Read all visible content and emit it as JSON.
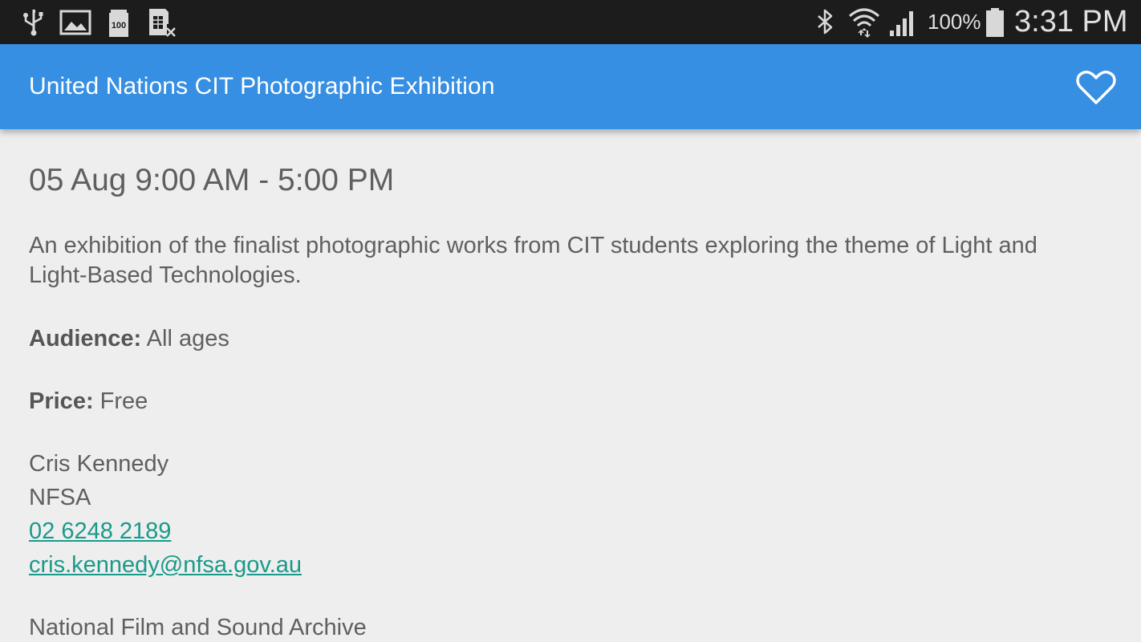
{
  "status_bar": {
    "icons_left": [
      "usb-icon",
      "image-icon",
      "storage-100-icon",
      "sim-off-icon"
    ],
    "icons_right": [
      "bluetooth-icon",
      "wifi-icon",
      "signal-icon",
      "battery-icon"
    ],
    "battery": "100%",
    "time": "3:31 PM"
  },
  "app_bar": {
    "title": "United Nations CIT Photographic Exhibition",
    "favorite_icon": "heart-outline-icon",
    "color": "#368fe2"
  },
  "event": {
    "datetime": "05 Aug 9:00 AM - 5:00 PM",
    "description": "An exhibition of the finalist photographic works from CIT students exploring the theme of Light and Light-Based Technologies.",
    "audience_label": "Audience:",
    "audience_value": "All ages",
    "price_label": "Price:",
    "price_value": "Free",
    "contact_name": "Cris Kennedy",
    "contact_org": "NFSA",
    "contact_phone": "02 6248 2189",
    "contact_email": "cris.kennedy@nfsa.gov.au",
    "venue": "National Film and Sound Archive",
    "link_color": "#1a9a8a"
  }
}
